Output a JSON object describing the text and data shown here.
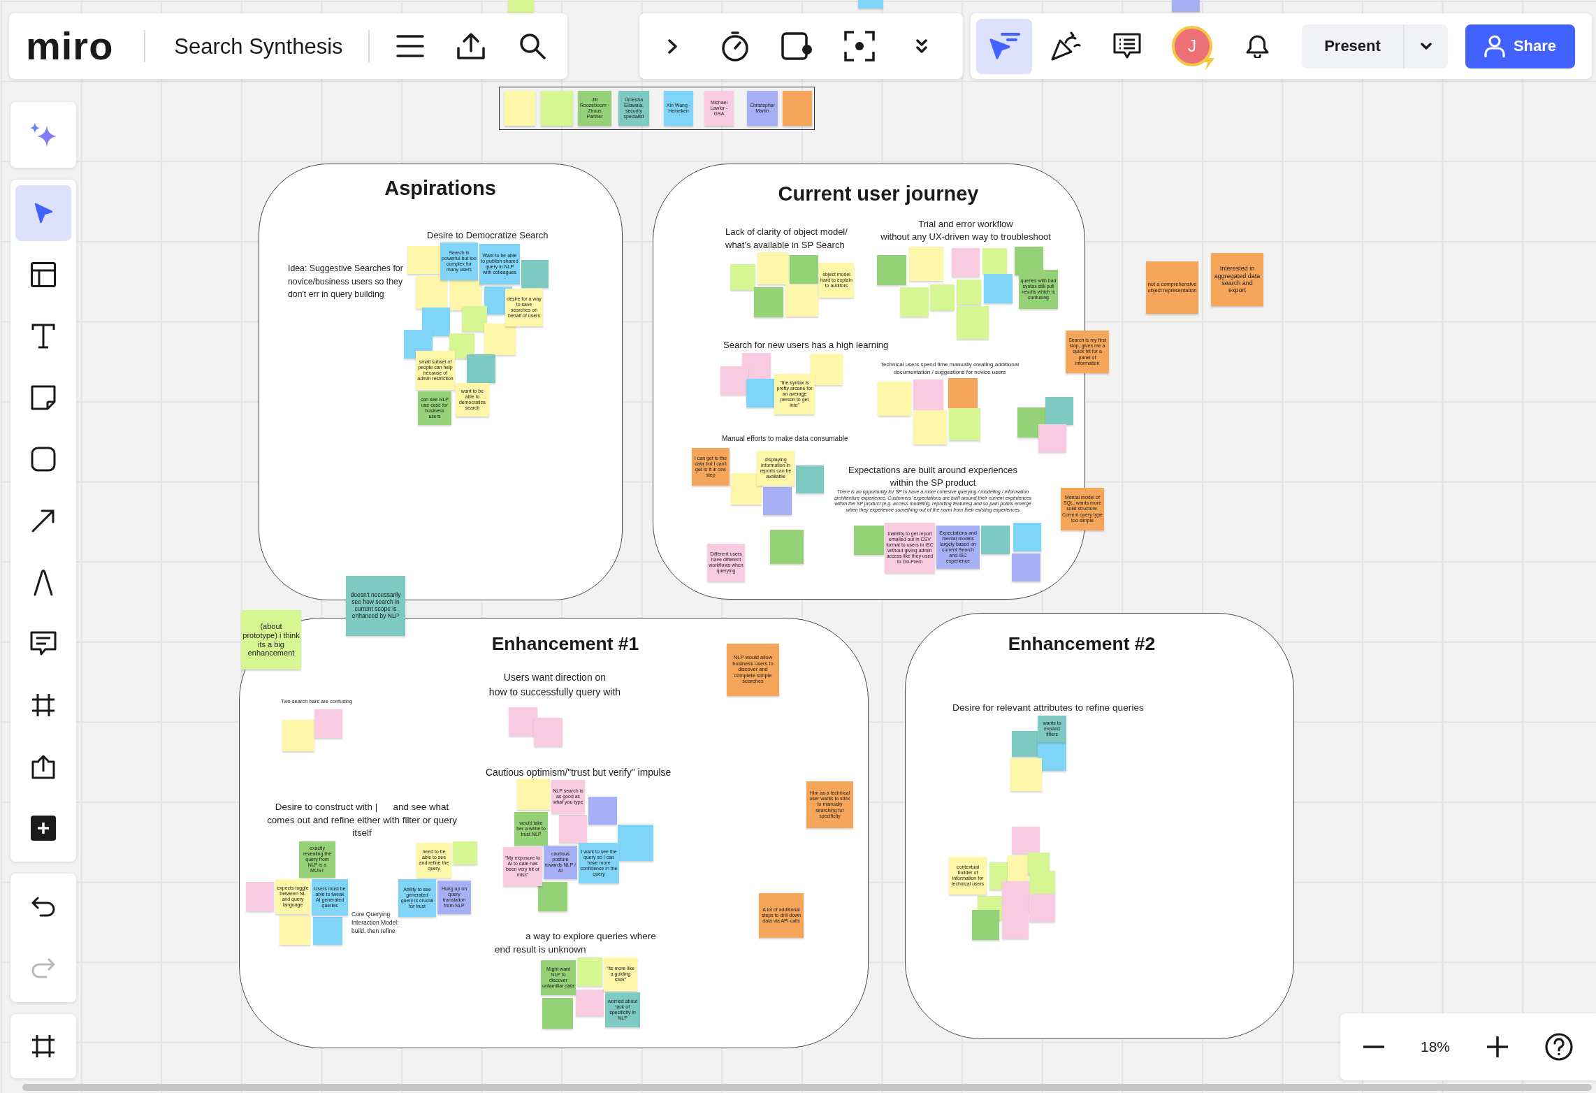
{
  "app_bar": {
    "logo": "miro",
    "board_title": "Search Synthesis"
  },
  "collab_tools": [
    {
      "kind": "attention",
      "selected": true
    },
    {
      "kind": "reactions",
      "selected": false
    },
    {
      "kind": "comments",
      "selected": false
    }
  ],
  "user": {
    "initial": "J"
  },
  "present_button": {
    "label": "Present"
  },
  "share_button": {
    "label": "Share"
  },
  "tools": [
    {
      "kind": "select",
      "selected": true
    },
    {
      "kind": "templates",
      "selected": false
    },
    {
      "kind": "text",
      "selected": false
    },
    {
      "kind": "sticky",
      "selected": false
    },
    {
      "kind": "shape",
      "selected": false
    },
    {
      "kind": "line",
      "selected": false
    },
    {
      "kind": "pen",
      "selected": false
    },
    {
      "kind": "comment",
      "selected": false
    },
    {
      "kind": "frame",
      "selected": false
    },
    {
      "kind": "upload",
      "selected": false
    },
    {
      "kind": "more",
      "selected": false
    }
  ],
  "history": [
    {
      "kind": "undo",
      "disabled": false
    },
    {
      "kind": "redo",
      "disabled": true
    }
  ],
  "zoom": {
    "level_text": "18%"
  },
  "legend": {
    "stickies": [
      {
        "color": "#fef6a8"
      },
      {
        "color": "#d6f593"
      },
      {
        "color": "#95d176",
        "text": "Jill Roozeboom - Zirous Partner"
      },
      {
        "color": "#7ec9c1",
        "text": "Umesha Ellawala, security specialist"
      },
      {
        "color": "#7fd4f7",
        "text": "Xin Wang - Heineken"
      },
      {
        "color": "#f9cbe0",
        "text": "Michael Lawlor - GSA"
      },
      {
        "color": "#a7b0f4",
        "text": "Christopher Martin"
      },
      {
        "color": "#f6a65b"
      }
    ]
  },
  "frames": [
    {
      "title": "Aspirations",
      "texts": [
        "Idea: Suggestive Searches for\nnovice/business users so they\ndon't err in query building"
      ],
      "groups": [
        {
          "heading": "Desire to Democratize Search",
          "stickies": [
            {
              "color": "#fef6a8"
            },
            {
              "color": "#7fd4f7",
              "text": "Search is powerful but too complex for many users"
            },
            {
              "color": "#7fd4f7",
              "text": "Want to be able to publish shared query in NLP with colleagues"
            },
            {
              "color": "#7ec9c1"
            },
            {
              "color": "#fef6a8"
            },
            {
              "color": "#fef6a8"
            },
            {
              "color": "#7fd4f7"
            },
            {
              "color": "#fef6a8",
              "text": "desire for a way to save searches on behalf of users"
            },
            {
              "color": "#7fd4f7"
            },
            {
              "color": "#d6f593"
            },
            {
              "color": "#fef6a8"
            },
            {
              "color": "#7fd4f7"
            },
            {
              "color": "#d6f593"
            },
            {
              "color": "#fef6a8",
              "text": "small subset of people can help because of admin restriction"
            },
            {
              "color": "#7ec9c1"
            },
            {
              "color": "#95d176",
              "text": "can see NLP use case for business users"
            },
            {
              "color": "#fef6a8",
              "text": "want to be able to democratize search"
            }
          ]
        }
      ]
    },
    {
      "title": "Current user journey",
      "groups": [
        {
          "heading": "Lack of clarity of object model/\nwhat's available in SP Search",
          "stickies": [
            {
              "color": "#d6f593"
            },
            {
              "color": "#fef6a8"
            },
            {
              "color": "#95d176"
            },
            {
              "color": "#fef6a8",
              "text": "object model hard to explain to auditors"
            },
            {
              "color": "#95d176"
            },
            {
              "color": "#fef6a8"
            }
          ]
        },
        {
          "heading": "Trial and error workflow\nwithout any UX-driven way to troubleshoot",
          "stickies": [
            {
              "color": "#95d176"
            },
            {
              "color": "#fef6a8"
            },
            {
              "color": "#f9cbe0"
            },
            {
              "color": "#d6f593"
            },
            {
              "color": "#95d176"
            },
            {
              "color": "#d6f593"
            },
            {
              "color": "#d6f593"
            },
            {
              "color": "#d6f593"
            },
            {
              "color": "#7fd4f7"
            },
            {
              "color": "#95d176",
              "text": "queries with bad syntax still pull results which is confusing"
            },
            {
              "color": "#d6f593"
            }
          ]
        },
        {
          "heading": "Search for new users has a high learning",
          "stickies": [
            {
              "color": "#f9cbe0"
            },
            {
              "color": "#fef6a8"
            },
            {
              "color": "#f9cbe0"
            },
            {
              "color": "#7fd4f7"
            },
            {
              "color": "#fef6a8",
              "text": "“the syntax is pretty arcane for an average person to get into”"
            }
          ]
        },
        {
          "heading": "Technical users spend time manually creating additional\ndocumentation / suggestions for novice users",
          "stickies": [
            {
              "color": "#fef6a8"
            },
            {
              "color": "#f9cbe0"
            },
            {
              "color": "#f6a65b"
            },
            {
              "color": "#fef6a8"
            },
            {
              "color": "#d6f593"
            }
          ]
        },
        {
          "heading": "Manual efforts to make data consumable",
          "stickies": [
            {
              "color": "#f6a65b",
              "text": "I can get to the data but I can't get to it in one step"
            },
            {
              "color": "#fef6a8",
              "text": "displaying information in reports can be available"
            },
            {
              "color": "#7ec9c1"
            },
            {
              "color": "#fef6a8"
            },
            {
              "color": "#a7b0f4"
            },
            {
              "color": "#f9cbe0",
              "text": "Different users have different workflows when querying"
            },
            {
              "color": "#95d176"
            }
          ]
        },
        {
          "heading": "Expectations are built around experiences\nwithin the SP product",
          "note": "There is an opportunity for SP to have a more cohesive querying / modeling / information architecture experience. Customers' expectations are built around their current experiences within the SP product (e.g. access modeling, reporting features) and so pain points emerge when they experience something out of the norm from their existing experiences",
          "stickies": [
            {
              "color": "#95d176"
            },
            {
              "color": "#f9cbe0",
              "text": "Inability to get report emailed out in CSV format to users in ISC without giving admin access like they used to On-Prem"
            },
            {
              "color": "#a7b0f4",
              "text": "Expectations and mental models largely based on current Search and ISC experience"
            },
            {
              "color": "#7ec9c1"
            },
            {
              "color": "#7fd4f7"
            },
            {
              "color": "#a7b0f4"
            }
          ]
        }
      ],
      "stickies": [
        {
          "color": "#95d176"
        },
        {
          "color": "#7ec9c1"
        },
        {
          "color": "#f9cbe0"
        }
      ]
    },
    {
      "title": "Enhancement #1",
      "stickies": [
        {
          "color": "#f6a65b",
          "text": "NLP would allow business users to discover and complete simple searches"
        },
        {
          "color": "#f6a65b",
          "text": "Him as a technical user wants to stick to manually searching for specificity"
        },
        {
          "color": "#f6a65b",
          "text": "A lot of additional steps to drill down data via API calls"
        }
      ],
      "groups": [
        {
          "heading": "Users want direction on\nhow to successfully query with",
          "stickies": [
            {
              "color": "#f9cbe0"
            },
            {
              "color": "#f9cbe0"
            }
          ]
        },
        {
          "heading": "Two search bars are confusing",
          "stickies": [
            {
              "color": "#fef6a8"
            },
            {
              "color": "#f9cbe0"
            }
          ]
        },
        {
          "heading": "Cautious optimism/\"trust but verify\" impulse",
          "stickies": [
            {
              "color": "#fef6a8"
            },
            {
              "color": "#f9cbe0",
              "text": "NLP search is as good as what you type"
            },
            {
              "color": "#a7b0f4"
            },
            {
              "color": "#95d176",
              "text": "would take her a while to trust NLP"
            },
            {
              "color": "#f9cbe0"
            },
            {
              "color": "#7fd4f7"
            },
            {
              "color": "#f9cbe0",
              "text": "“My exposure to AI to date has been very hit or miss”"
            },
            {
              "color": "#a7b0f4",
              "text": "cautious posture towards NLP / AI"
            },
            {
              "color": "#7fd4f7",
              "text": "I want to see the query so I can have more confidence in the query"
            },
            {
              "color": "#95d176"
            }
          ]
        },
        {
          "heading": "Desire to construct with |      and see what\ncomes out and refine either with filter or query\nitself",
          "note": "Core Querying\nInteraction Model:\nbuild, then refine",
          "stickies": [
            {
              "color": "#95d176",
              "text": "exactly revealing the query from NLP is a MUST"
            },
            {
              "color": "#fef6a8",
              "text": "need to be able to see and refine the query"
            },
            {
              "color": "#d6f593"
            },
            {
              "color": "#f9cbe0"
            },
            {
              "color": "#fef6a8",
              "text": "expects toggle between NL and query language"
            },
            {
              "color": "#7fd4f7",
              "text": "Users must be able to tweak AI generated queries"
            },
            {
              "color": "#7fd4f7",
              "text": "Ability to see generated query is crucial for trust"
            },
            {
              "color": "#a7b0f4",
              "text": "Hung up on query translation from NLP"
            },
            {
              "color": "#fef6a8"
            },
            {
              "color": "#7fd4f7"
            }
          ]
        },
        {
          "heading": "a way to explore queries where\nend result is unknown",
          "stickies": [
            {
              "color": "#95d176",
              "text": "Might want NLP to discover unfamiliar data"
            },
            {
              "color": "#d6f593"
            },
            {
              "color": "#fef6a8",
              "text": "“its more like a guiding stick”"
            },
            {
              "color": "#95d176"
            },
            {
              "color": "#f9cbe0"
            },
            {
              "color": "#7ec9c1",
              "text": "worried about lack of specificity in NLP"
            }
          ]
        }
      ]
    },
    {
      "title": "Enhancement #2",
      "groups": [
        {
          "heading": "Desire for relevant attributes to refine queries",
          "stickies": [
            {
              "color": "#7ec9c1"
            },
            {
              "color": "#7ec9c1",
              "text": "wants to expand filters"
            },
            {
              "color": "#7fd4f7"
            },
            {
              "color": "#fef6a8"
            }
          ]
        }
      ],
      "stickies": [
        {
          "color": "#f9cbe0"
        },
        {
          "color": "#fef6a8",
          "text": "contextual builder of information for technical users"
        },
        {
          "color": "#d6f593"
        },
        {
          "color": "#fef6a8"
        },
        {
          "color": "#d6f593"
        },
        {
          "color": "#d6f593"
        },
        {
          "color": "#f9cbe0"
        },
        {
          "color": "#d6f593"
        },
        {
          "color": "#f9cbe0"
        },
        {
          "color": "#95d176"
        },
        {
          "color": "#f9cbe0"
        }
      ]
    }
  ],
  "loose_stickies": [
    {
      "color": "#d6f593"
    },
    {
      "color": "#7fd4f7"
    },
    {
      "color": "#a7b0f4"
    },
    {
      "color": "#f6a65b",
      "text": "not a comprehensive object representation"
    },
    {
      "color": "#f6a65b",
      "text": "Interested in aggregated data search and export"
    },
    {
      "color": "#f6a65b",
      "text": "Search is my first stop, gives me a quick hit for a panel of information"
    },
    {
      "color": "#f6a65b",
      "text": "Mental model of SQL, wants more solid structure. Current query type too simple"
    },
    {
      "color": "#d6f593",
      "text": "(about prototype) i think its a big enhancement"
    },
    {
      "color": "#7ec9c1",
      "text": "doesn't necessarily see how search in current scope is enhanced by NLP"
    }
  ]
}
